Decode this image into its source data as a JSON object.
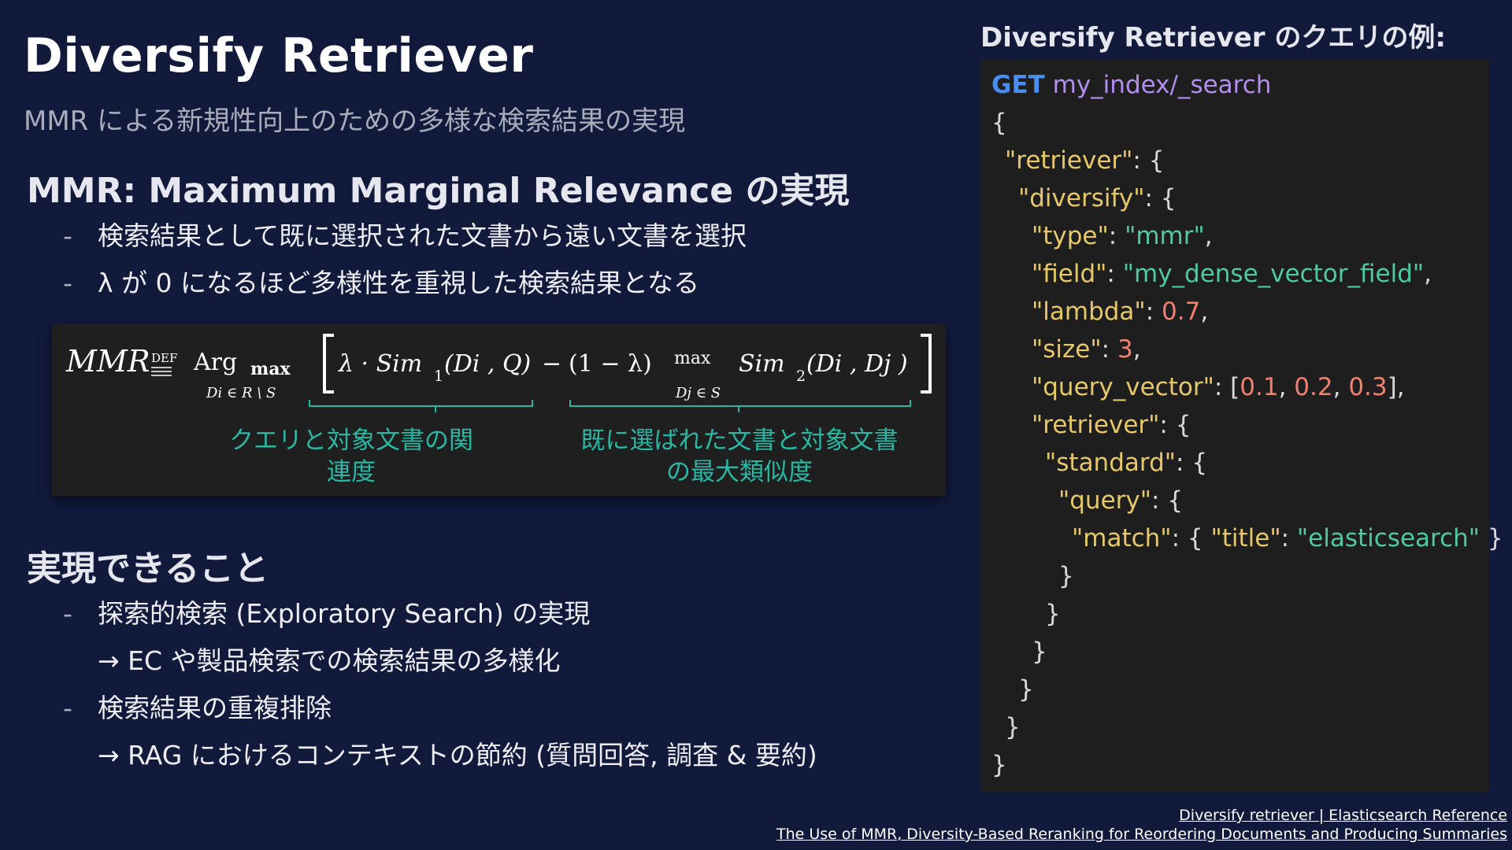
{
  "slide": {
    "title": "Diversify Retriever",
    "subtitle": "MMR による新規性向上のための多様な検索結果の実現"
  },
  "mmr_section": {
    "heading": "MMR: Maximum Marginal Relevance の実現",
    "bullets": [
      "検索結果として既に選択された文書から遠い文書を選択",
      "λ が 0 になるほど多様性を重視した検索結果となる"
    ]
  },
  "formula": {
    "mmr": "MMR",
    "def": "DEF",
    "arg": "Arg",
    "max": "max",
    "arg_sub": "Di ∈ R \\ S",
    "lambda_sim1": "λ · Sim",
    "sub1": "1",
    "sim1_args": "(Di , Q)",
    "minus": "−",
    "one_minus_lambda": "(1 − λ)",
    "max2": "max",
    "max2_sub": "Dj ∈ S",
    "sim2": "Sim",
    "sub2": "2",
    "sim2_args": "(Di , Dj )",
    "annotation_left": "クエリと対象文書の関連度",
    "annotation_right_line1": "既に選ばれた文書と対象文書",
    "annotation_right_line2": "の最大類似度"
  },
  "achievements": {
    "heading": "実現できること",
    "items": [
      {
        "text": "探索的検索 (Exploratory Search) の実現",
        "sub": "→ EC や製品検索での検索結果の多様化"
      },
      {
        "text": "検索結果の重複排除",
        "sub": "→ RAG におけるコンテキストの節約 (質問回答, 調査 & 要約)"
      }
    ]
  },
  "code_example": {
    "title": "Diversify Retriever のクエリの例:",
    "method": "GET",
    "endpoint": "my_index/_search",
    "lines": [
      {
        "indent": 0,
        "parts": [
          {
            "t": "p",
            "v": "{"
          }
        ]
      },
      {
        "indent": 1,
        "parts": [
          {
            "t": "key",
            "v": "\"retriever\""
          },
          {
            "t": "p",
            "v": ": {"
          }
        ]
      },
      {
        "indent": 2,
        "parts": [
          {
            "t": "key",
            "v": "\"diversify\""
          },
          {
            "t": "p",
            "v": ": {"
          }
        ]
      },
      {
        "indent": 3,
        "parts": [
          {
            "t": "key",
            "v": "\"type\""
          },
          {
            "t": "p",
            "v": ": "
          },
          {
            "t": "str",
            "v": "\"mmr\""
          },
          {
            "t": "p",
            "v": ","
          }
        ]
      },
      {
        "indent": 3,
        "parts": [
          {
            "t": "key",
            "v": "\"field\""
          },
          {
            "t": "p",
            "v": ": "
          },
          {
            "t": "str",
            "v": "\"my_dense_vector_field\""
          },
          {
            "t": "p",
            "v": ","
          }
        ]
      },
      {
        "indent": 3,
        "parts": [
          {
            "t": "key",
            "v": "\"lambda\""
          },
          {
            "t": "p",
            "v": ": "
          },
          {
            "t": "num",
            "v": "0.7"
          },
          {
            "t": "p",
            "v": ","
          }
        ]
      },
      {
        "indent": 3,
        "parts": [
          {
            "t": "key",
            "v": "\"size\""
          },
          {
            "t": "p",
            "v": ": "
          },
          {
            "t": "num",
            "v": "3"
          },
          {
            "t": "p",
            "v": ","
          }
        ]
      },
      {
        "indent": 3,
        "parts": [
          {
            "t": "key",
            "v": "\"query_vector\""
          },
          {
            "t": "p",
            "v": ": ["
          },
          {
            "t": "num",
            "v": "0.1"
          },
          {
            "t": "p",
            "v": ", "
          },
          {
            "t": "num",
            "v": "0.2"
          },
          {
            "t": "p",
            "v": ", "
          },
          {
            "t": "num",
            "v": "0.3"
          },
          {
            "t": "p",
            "v": "],"
          }
        ]
      },
      {
        "indent": 3,
        "parts": [
          {
            "t": "key",
            "v": "\"retriever\""
          },
          {
            "t": "p",
            "v": ": {"
          }
        ]
      },
      {
        "indent": 4,
        "parts": [
          {
            "t": "key",
            "v": "\"standard\""
          },
          {
            "t": "p",
            "v": ": {"
          }
        ]
      },
      {
        "indent": 5,
        "parts": [
          {
            "t": "key",
            "v": "\"query\""
          },
          {
            "t": "p",
            "v": ": {"
          }
        ]
      },
      {
        "indent": 6,
        "parts": [
          {
            "t": "key",
            "v": "\"match\""
          },
          {
            "t": "p",
            "v": ": { "
          },
          {
            "t": "key",
            "v": "\"title\""
          },
          {
            "t": "p",
            "v": ": "
          },
          {
            "t": "str",
            "v": "\"elasticsearch\""
          },
          {
            "t": "p",
            "v": " }"
          }
        ]
      },
      {
        "indent": 5,
        "parts": [
          {
            "t": "p",
            "v": "}"
          }
        ]
      },
      {
        "indent": 4,
        "parts": [
          {
            "t": "p",
            "v": "}"
          }
        ]
      },
      {
        "indent": 3,
        "parts": [
          {
            "t": "p",
            "v": "}"
          }
        ]
      },
      {
        "indent": 2,
        "parts": [
          {
            "t": "p",
            "v": "}"
          }
        ]
      },
      {
        "indent": 1,
        "parts": [
          {
            "t": "p",
            "v": "}"
          }
        ]
      },
      {
        "indent": 0,
        "parts": [
          {
            "t": "p",
            "v": "}"
          }
        ]
      }
    ]
  },
  "references": [
    "Diversify retriever | Elasticsearch Reference",
    "The Use of MMR, Diversity-Based Reranking for Reordering  Documents and Producing Summaries"
  ],
  "colors": {
    "background": "#121a3c",
    "code_bg": "#1e1e1e",
    "annotation": "#2bb7a3",
    "keyword": "#4a8df0",
    "url": "#b38df0",
    "key": "#e6c86a",
    "string": "#4ec9a0",
    "number": "#f08070"
  }
}
